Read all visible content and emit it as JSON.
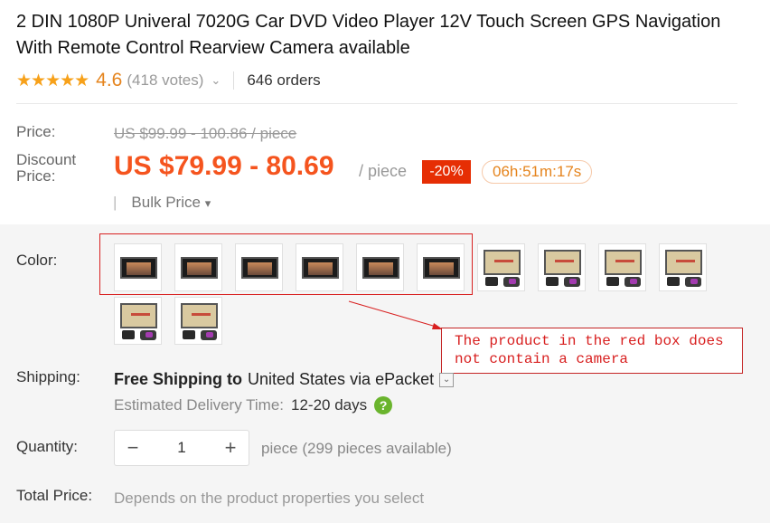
{
  "product": {
    "title": "2 DIN 1080P Univeral 7020G Car DVD Video Player 12V Touch Screen GPS Navigation With Remote Control Rearview Camera available",
    "stars": "★★★★★",
    "rating": "4.6",
    "votes": "(418 votes)",
    "orders": "646 orders"
  },
  "price": {
    "label": "Price:",
    "original": "US $99.99 - 100.86 / piece",
    "discount_label": "Discount Price:",
    "discount": "US $79.99 - 80.69",
    "unit": "/ piece",
    "percent_off": "-20%",
    "countdown": "06h:51m:17s",
    "bulk_label": "Bulk Price",
    "bulk_arrow": "▾"
  },
  "color": {
    "label": "Color:",
    "options": [
      {
        "name": "color-option-1",
        "variant": "dvd-screen"
      },
      {
        "name": "color-option-2",
        "variant": "dvd-screen"
      },
      {
        "name": "color-option-3",
        "variant": "dvd-screen"
      },
      {
        "name": "color-option-4",
        "variant": "dvd-screen"
      },
      {
        "name": "color-option-5",
        "variant": "dvd-screen"
      },
      {
        "name": "color-option-6",
        "variant": "dvd-screen"
      },
      {
        "name": "color-option-7",
        "variant": "gps-with-camera"
      },
      {
        "name": "color-option-8",
        "variant": "gps-with-camera"
      },
      {
        "name": "color-option-9",
        "variant": "gps-with-camera"
      },
      {
        "name": "color-option-10",
        "variant": "gps-with-camera"
      },
      {
        "name": "color-option-11",
        "variant": "gps-with-camera"
      },
      {
        "name": "color-option-12",
        "variant": "gps-with-camera"
      }
    ]
  },
  "annotation": {
    "text": "The product in the red box does not contain a camera",
    "color": "#d82020"
  },
  "shipping": {
    "label": "Shipping:",
    "free": "Free Shipping to",
    "destination": "United States via ePacket",
    "dropdown_icon": "chevron-down-icon",
    "est_label": "Estimated Delivery Time:",
    "est_days": "12-20 days",
    "help_icon": "?"
  },
  "quantity": {
    "label": "Quantity:",
    "minus": "−",
    "value": "1",
    "plus": "+",
    "available": "piece (299 pieces available)"
  },
  "total": {
    "label": "Total Price:",
    "text": "Depends on the product properties you select"
  },
  "colors": {
    "accent": "#f5541e",
    "rating": "#e5841d",
    "badge": "#e62e04",
    "help": "#6ab42d"
  }
}
